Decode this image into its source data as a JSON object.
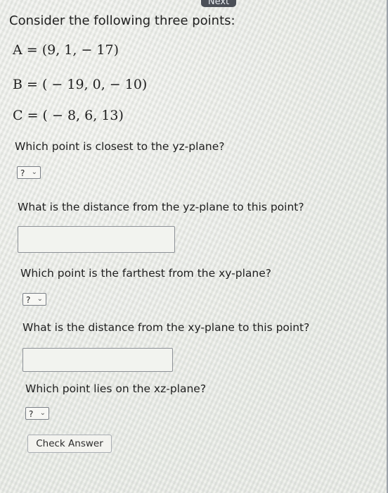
{
  "header": {
    "next_label": "Next"
  },
  "intro": "Consider the following three points:",
  "points": {
    "a": "A = (9, 1,  − 17)",
    "b": "B = ( − 19, 0,  − 10)",
    "c": "C = ( − 8, 6, 13)"
  },
  "questions": {
    "q1": "Which point is closest to the yz-plane?",
    "q2": "What is the distance from the yz-plane to this point?",
    "q3": "Which point is the farthest from the xy-plane?",
    "q4": "What is the distance from the xy-plane to this point?",
    "q5": "Which point lies on the xz-plane?"
  },
  "dropdowns": {
    "d1": {
      "value": "?"
    },
    "d2": {
      "value": "?"
    },
    "d3": {
      "value": "?"
    }
  },
  "inputs": {
    "in1": {
      "value": ""
    },
    "in2": {
      "value": ""
    }
  },
  "check_answer_label": "Check Answer"
}
